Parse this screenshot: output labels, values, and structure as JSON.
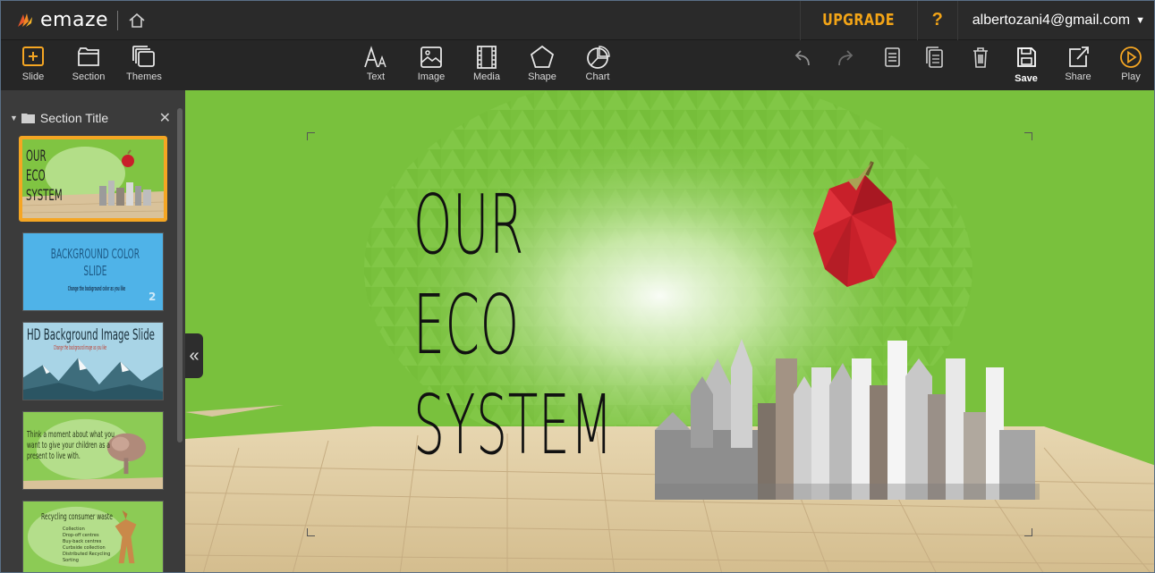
{
  "topbar": {
    "brand": "emaze",
    "upgrade": "UPGRADE",
    "help": "?",
    "account": "albertozani4@gmail.com"
  },
  "toolbar": {
    "slide": "Slide",
    "section": "Section",
    "themes": "Themes",
    "text": "Text",
    "image": "Image",
    "media": "Media",
    "shape": "Shape",
    "chart": "Chart",
    "save": "Save",
    "share": "Share",
    "play": "Play"
  },
  "sidebar": {
    "section_title": "Section Title",
    "slides": [
      {
        "title": "OUR ECO SYSTEM"
      },
      {
        "title": "BACKGROUND COLOR SLIDE",
        "subtitle": "Change the background color as you like",
        "number": "2"
      },
      {
        "title": "HD Background Image Slide",
        "subtitle": "Change the background image as you like"
      },
      {
        "title": "Think a moment about what you want to give your children as a present to live with."
      },
      {
        "title": "Recycling consumer waste",
        "bullets": [
          "Collection",
          "Drop-off centres",
          "Buy-back centres",
          "Curbside collection",
          "Distributed Recycling",
          "Sorting"
        ]
      }
    ]
  },
  "slide": {
    "title": "OUR ECO\nSYSTEM"
  },
  "colors": {
    "accent": "#f5a623",
    "upgrade": "#f2a417",
    "canvas_green": "#79c13d",
    "slide2_blue": "#4fb3e8"
  }
}
